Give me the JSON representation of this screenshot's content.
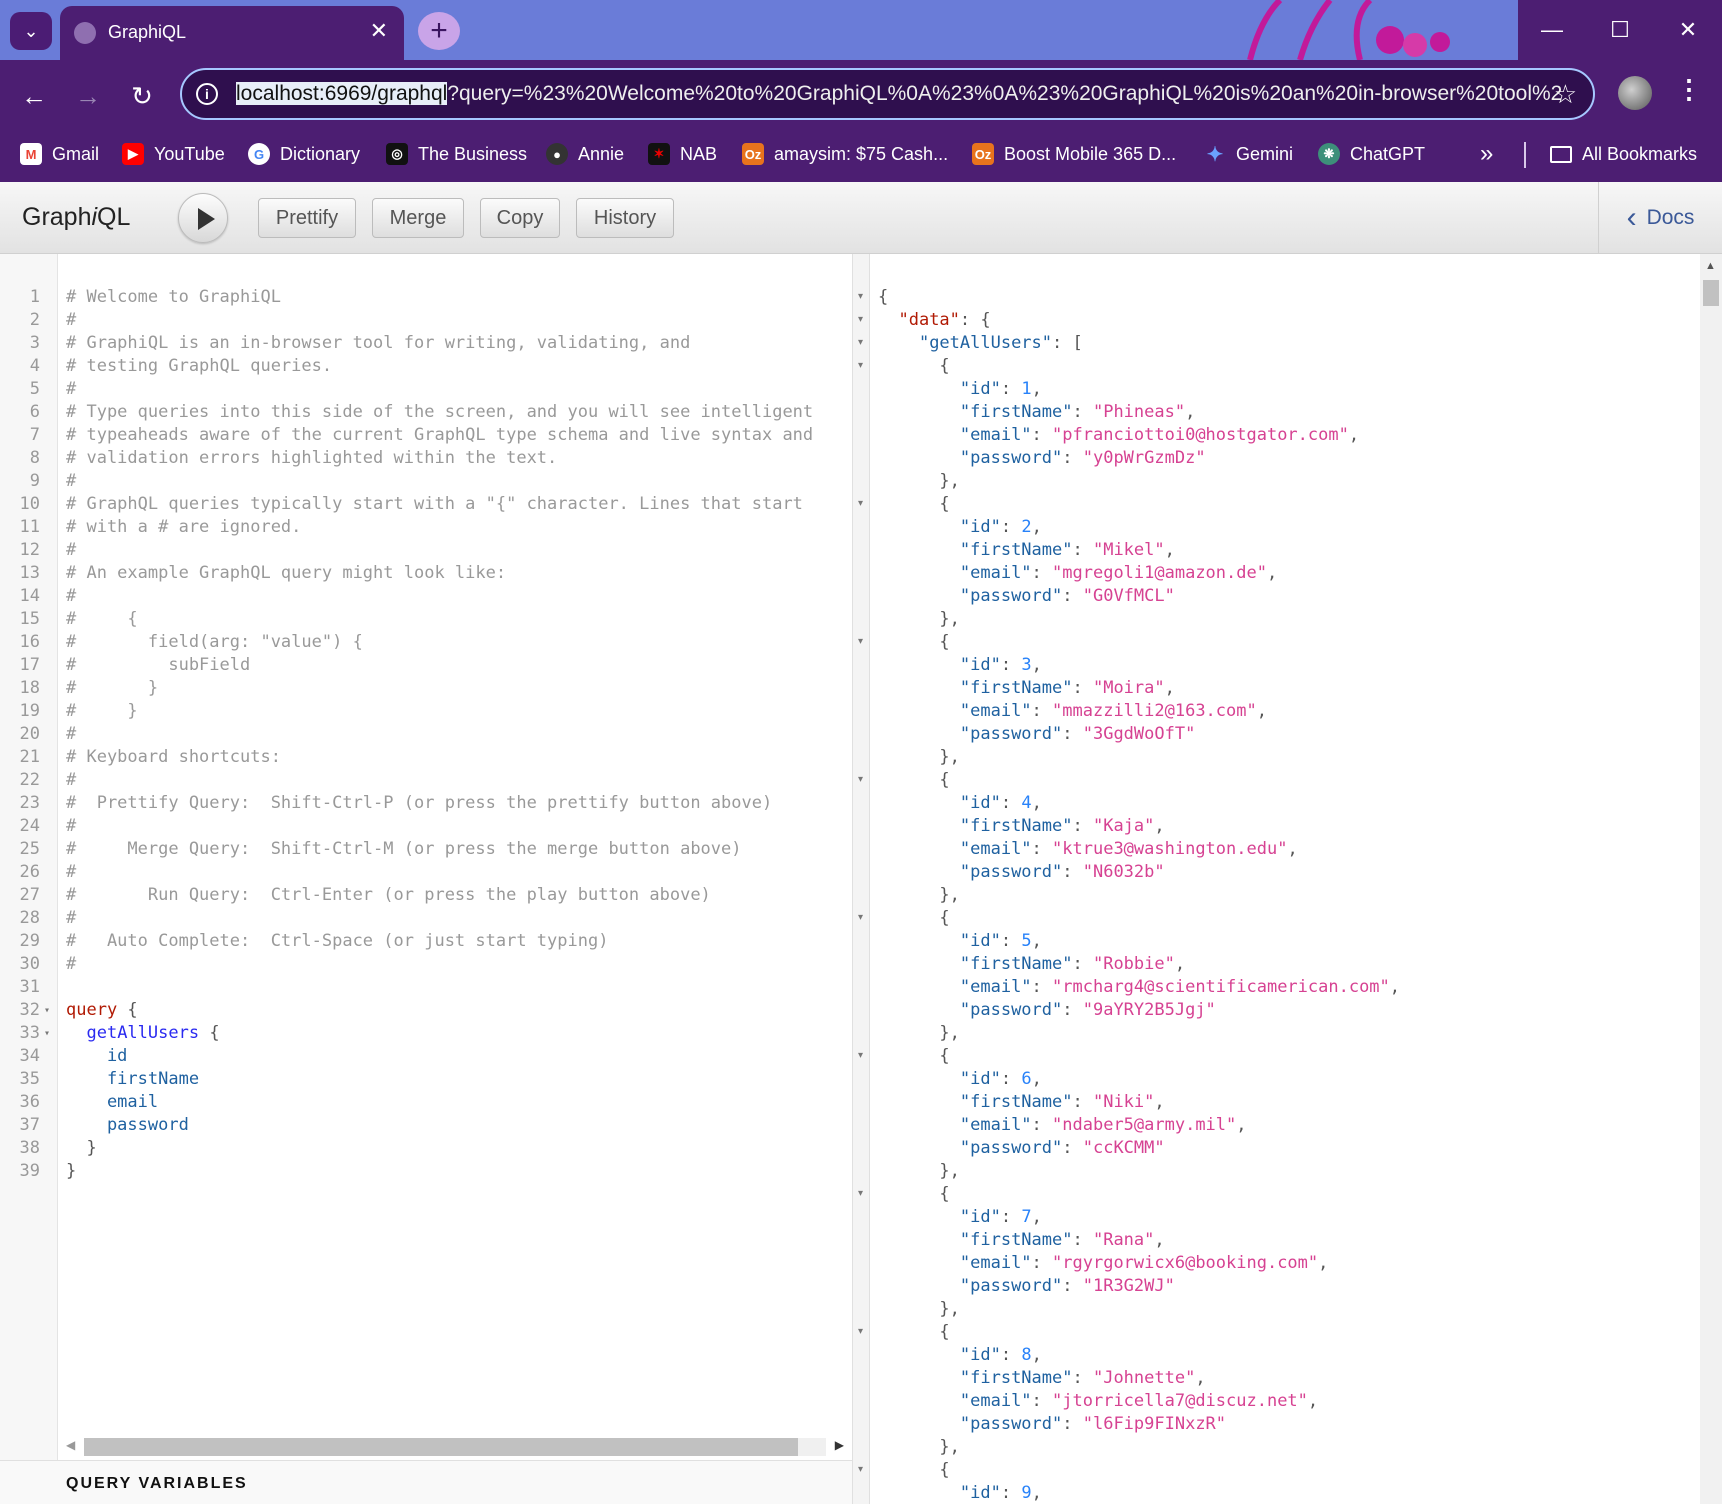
{
  "browser": {
    "tab_title": "GraphiQL",
    "tab_close": "✕",
    "new_tab": "+",
    "url_selected": "localhost:6969/graphql",
    "url_rest": "?query=%23%20Welcome%20to%20GraphiQL%0A%23%0A%23%20GraphiQL%20is%20an%20in-browser%20tool%2",
    "bookmarks": [
      {
        "label": "Gmail",
        "icon": "gmail-icon"
      },
      {
        "label": "YouTube",
        "icon": "youtube-icon"
      },
      {
        "label": "Dictionary",
        "icon": "google-icon"
      },
      {
        "label": "The Business",
        "icon": "abc-icon"
      },
      {
        "label": "Annie",
        "icon": "github-icon"
      },
      {
        "label": "NAB",
        "icon": "nab-icon"
      },
      {
        "label": "amaysim: $75 Cash...",
        "icon": "oz-icon"
      },
      {
        "label": "Boost Mobile 365 D...",
        "icon": "oz-icon"
      },
      {
        "label": "Gemini",
        "icon": "gemini-icon"
      },
      {
        "label": "ChatGPT",
        "icon": "chatgpt-icon"
      }
    ],
    "bookmarks_overflow": "»",
    "all_bookmarks": "All Bookmarks",
    "colors": {
      "tabstrip": "#6a7cd8",
      "frame": "#4c1e72",
      "omnibox": "#2f0f4e"
    }
  },
  "graphiql": {
    "title_prefix": "Graph",
    "title_italic": "i",
    "title_suffix": "QL",
    "buttons": {
      "prettify": "Prettify",
      "merge": "Merge",
      "copy": "Copy",
      "history": "History"
    },
    "docs": "Docs",
    "query_variables": "QUERY VARIABLES",
    "editor_lines": [
      "# Welcome to GraphiQL",
      "#",
      "# GraphiQL is an in-browser tool for writing, validating, and",
      "# testing GraphQL queries.",
      "#",
      "# Type queries into this side of the screen, and you will see intelligent",
      "# typeaheads aware of the current GraphQL type schema and live syntax and",
      "# validation errors highlighted within the text.",
      "#",
      "# GraphQL queries typically start with a \"{\" character. Lines that start",
      "# with a # are ignored.",
      "#",
      "# An example GraphQL query might look like:",
      "#",
      "#     {",
      "#       field(arg: \"value\") {",
      "#         subField",
      "#       }",
      "#     }",
      "#",
      "# Keyboard shortcuts:",
      "#",
      "#  Prettify Query:  Shift-Ctrl-P (or press the prettify button above)",
      "#",
      "#     Merge Query:  Shift-Ctrl-M (or press the merge button above)",
      "#",
      "#       Run Query:  Ctrl-Enter (or press the play button above)",
      "#",
      "#   Auto Complete:  Ctrl-Space (or just start typing)",
      "#",
      "",
      "query {",
      "  getAllUsers {",
      "    id",
      "    firstName",
      "    email",
      "    password",
      "  }",
      "}"
    ],
    "result": {
      "data_key": "data",
      "query_key": "getAllUsers",
      "users": [
        {
          "id": 1,
          "firstName": "Phineas",
          "email": "pfranciottoi0@hostgator.com",
          "password": "y0pWrGzmDz"
        },
        {
          "id": 2,
          "firstName": "Mikel",
          "email": "mgregoli1@amazon.de",
          "password": "G0VfMCL"
        },
        {
          "id": 3,
          "firstName": "Moira",
          "email": "mmazzilli2@163.com",
          "password": "3GgdWoOfT"
        },
        {
          "id": 4,
          "firstName": "Kaja",
          "email": "ktrue3@washington.edu",
          "password": "N6032b"
        },
        {
          "id": 5,
          "firstName": "Robbie",
          "email": "rmcharg4@scientificamerican.com",
          "password": "9aYRY2B5Jgj"
        },
        {
          "id": 6,
          "firstName": "Niki",
          "email": "ndaber5@army.mil",
          "password": "ccKCMM"
        },
        {
          "id": 7,
          "firstName": "Rana",
          "email": "rgyrgorwicx6@booking.com",
          "password": "1R3G2WJ"
        },
        {
          "id": 8,
          "firstName": "Johnette",
          "email": "jtorricella7@discuz.net",
          "password": "l6Fip9FINxzR"
        },
        {
          "id": 9
        }
      ]
    }
  }
}
